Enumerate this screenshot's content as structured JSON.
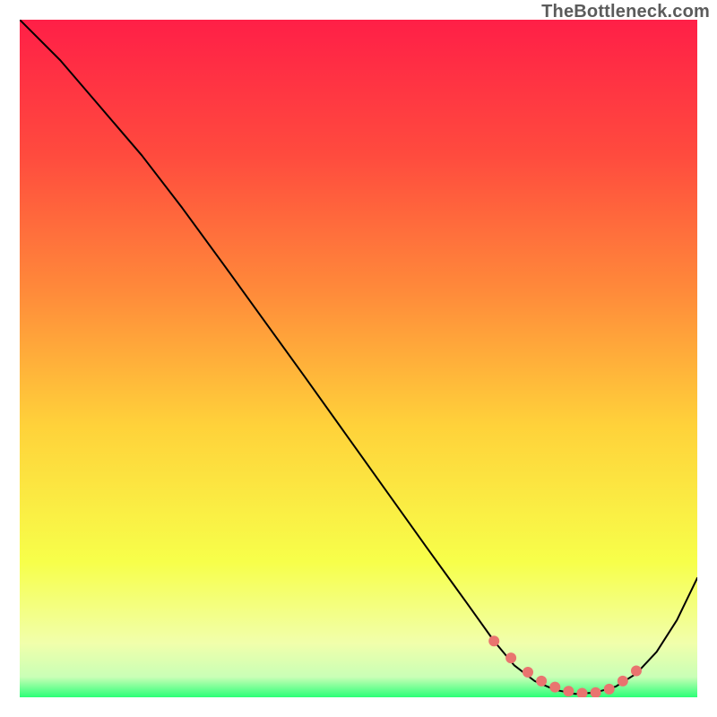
{
  "watermark": "TheBottleneck.com",
  "chart_data": {
    "type": "line",
    "title": "",
    "xlabel": "",
    "ylabel": "",
    "xlim": [
      0,
      100
    ],
    "ylim": [
      0,
      100
    ],
    "gradient_stops": [
      {
        "offset": 0,
        "color": "#ff1f47"
      },
      {
        "offset": 20,
        "color": "#ff4b3e"
      },
      {
        "offset": 40,
        "color": "#ff8a3a"
      },
      {
        "offset": 60,
        "color": "#ffd23a"
      },
      {
        "offset": 80,
        "color": "#f7ff4a"
      },
      {
        "offset": 92,
        "color": "#f1ffab"
      },
      {
        "offset": 97,
        "color": "#c9ffb6"
      },
      {
        "offset": 100,
        "color": "#2bff77"
      }
    ],
    "series": [
      {
        "name": "bottleneck-curve",
        "color": "#000000",
        "x": [
          0,
          6,
          12,
          18,
          24,
          30,
          36,
          42,
          48,
          54,
          60,
          66,
          70,
          73,
          76,
          79,
          82,
          85,
          88,
          91,
          94,
          97,
          100
        ],
        "y": [
          100,
          94,
          87,
          80,
          72.2,
          64,
          55.7,
          47.4,
          39,
          30.6,
          22.2,
          13.9,
          8.3,
          4.7,
          2.4,
          1.1,
          0.5,
          0.7,
          1.6,
          3.5,
          6.7,
          11.4,
          17.6
        ]
      }
    ],
    "markers": {
      "name": "optimal-zone",
      "color": "#e9746f",
      "radius_px": 6,
      "x": [
        70,
        72.5,
        75,
        77,
        79,
        81,
        83,
        85,
        87,
        89,
        91
      ],
      "y": [
        8.3,
        5.8,
        3.7,
        2.4,
        1.5,
        0.9,
        0.6,
        0.7,
        1.2,
        2.4,
        3.9
      ]
    }
  }
}
